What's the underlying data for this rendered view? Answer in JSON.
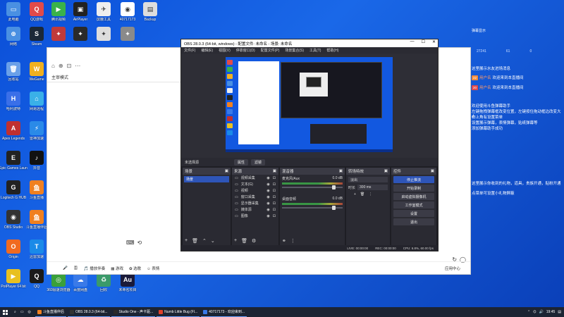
{
  "desktop": {
    "icons": [
      {
        "label": "此电脑",
        "color": "#4a90e2",
        "glyph": "▭"
      },
      {
        "label": "QQ游戏",
        "color": "#e24a4a",
        "glyph": "Q"
      },
      {
        "label": "腾讯视频",
        "color": "#3ab24a",
        "glyph": "▶"
      },
      {
        "label": "AirPlayer",
        "color": "#222",
        "glyph": "▣"
      },
      {
        "label": "屏蔽工具",
        "color": "#eee",
        "glyph": "✈"
      },
      {
        "label": "40717173",
        "color": "#fff",
        "glyph": "◉"
      },
      {
        "label": "Backup",
        "color": "#ddd",
        "glyph": "▤"
      },
      {
        "label": "网络",
        "color": "#4a90e2",
        "glyph": "⊕"
      },
      {
        "label": "Steam",
        "color": "#1b2838",
        "glyph": "S"
      },
      {
        "label": "",
        "color": "#c03a3a",
        "glyph": "✦"
      },
      {
        "label": "",
        "color": "#2a2a2a",
        "glyph": "✦"
      },
      {
        "label": "",
        "color": "#ddd",
        "glyph": "✦"
      },
      {
        "label": "",
        "color": "#8a8a8a",
        "glyph": "✦"
      },
      {
        "label": "回收站",
        "color": "#6aa0e8",
        "glyph": "🗑"
      },
      {
        "label": "WeGame",
        "color": "#f0b020",
        "glyph": "W"
      },
      {
        "label": "哈利波特",
        "color": "#3a6fe8",
        "glyph": "H"
      },
      {
        "label": "网易远程",
        "color": "#3ab0e8",
        "glyph": "⌂"
      },
      {
        "label": "Apex Legends",
        "color": "#c03030",
        "glyph": "A"
      },
      {
        "label": "雷神加速",
        "color": "#2a8ae8",
        "glyph": "⚡"
      },
      {
        "label": "Epic Games Launcher",
        "color": "#222",
        "glyph": "E"
      },
      {
        "label": "抖音",
        "color": "#111",
        "glyph": "♪"
      },
      {
        "label": "Logitech G HUB",
        "color": "#222",
        "glyph": "G"
      },
      {
        "label": "斗鱼直播",
        "color": "#f08020",
        "glyph": "鱼"
      },
      {
        "label": "OBS Studio",
        "color": "#333",
        "glyph": "◉"
      },
      {
        "label": "斗鱼直播伴侣",
        "color": "#f08020",
        "glyph": "鱼"
      },
      {
        "label": "Origin",
        "color": "#f06a20",
        "glyph": "O"
      },
      {
        "label": "迅雷加速",
        "color": "#1a8ae8",
        "glyph": "T"
      },
      {
        "label": "PotPlayer 64 bit",
        "color": "#e8c020",
        "glyph": "▶"
      },
      {
        "label": "QQ",
        "color": "#1a1a1a",
        "glyph": "Q"
      },
      {
        "label": "360极速浏览器",
        "color": "#3aa03a",
        "glyph": "◎"
      },
      {
        "label": "百度网盘",
        "color": "#3a7ae8",
        "glyph": "☁"
      },
      {
        "label": "回收",
        "color": "#3a9a6a",
        "glyph": "♻"
      },
      {
        "label": "未命名项目",
        "color": "#1a1a3a",
        "glyph": "Au"
      }
    ]
  },
  "helper": {
    "mode_label": "主审模式",
    "bottom_items": [
      "🎤",
      "🎚",
      "🎵 播放伴奏",
      "▦ 游戏",
      "✿ 选歌",
      "☺ 表情"
    ],
    "app_center": "应用中心"
  },
  "obs": {
    "title": "OBS 28.0.3 (64-bit, windows) - 配置文件: 未命名 - 场景: 未命名",
    "menus": [
      "文件(F)",
      "编辑(E)",
      "视图(V)",
      "停靠窗口(D)",
      "配置文件(P)",
      "场景集合(S)",
      "工具(T)",
      "帮助(H)"
    ],
    "context_label": "未选择源",
    "context_buttons": [
      "属性",
      "滤镜"
    ],
    "docks": {
      "scenes": {
        "title": "场景",
        "items": [
          "场景"
        ]
      },
      "sources": {
        "title": "来源",
        "items": [
          "视频采集",
          "文本(G)",
          "视频",
          "窗口采集",
          "显示器采集",
          "媒体源",
          "图像"
        ]
      },
      "mixer": {
        "title": "混音器",
        "channels": [
          {
            "name": "麦克风/Aux",
            "db": "0.0 dB"
          },
          {
            "name": "桌面音频",
            "db": "0.0 dB"
          }
        ]
      },
      "transitions": {
        "title": "转场特效",
        "selected": "淡出",
        "duration_label": "时长",
        "duration_value": "300 ms"
      },
      "controls": {
        "title": "控件",
        "buttons": [
          "停止推流",
          "开始录制",
          "启动虚拟摄像机",
          "工作室模式",
          "设置",
          "退出"
        ]
      }
    },
    "status": {
      "live": "LIVE: 00:00:00",
      "rec": "REC: 00:00:00",
      "cpu": "CPU: 6.8%, 60.00 fps"
    }
  },
  "chat": {
    "title": "弹幕显示",
    "stats": [
      "27241",
      "61",
      "0"
    ],
    "messages": [
      {
        "type": "system",
        "text": "这里展示水友进场消息"
      },
      {
        "type": "entry",
        "tag": "22",
        "user": "用户名",
        "text": "欢迎来到本直播间"
      },
      {
        "type": "entry",
        "tag": "20",
        "user": "用户名",
        "text": "欢迎来到本直播间"
      },
      {
        "type": "system",
        "text": "欢迎使用斗鱼弹幕助手"
      },
      {
        "type": "system",
        "text": "左键拖拽弹幕框改变位置，左键按住拖动框边改变大小"
      },
      {
        "type": "system",
        "text": "右上角有设置菜单"
      },
      {
        "type": "system",
        "text": "设置展示弹幕，表情弹幕，贴纸弹幕等"
      },
      {
        "type": "system",
        "text": "添加弹幕助手成功"
      },
      {
        "type": "system",
        "text": "这里展示你收到的礼物，道具，贵族开通，贴粉开通"
      },
      {
        "type": "system",
        "text": "点菜单可设置小礼物屏蔽"
      }
    ]
  },
  "taskbar": {
    "items": [
      {
        "label": "斗鱼直播伴侣",
        "color": "#f08020"
      },
      {
        "label": "OBS 28.0.3 (64-bit...",
        "color": "#333"
      },
      {
        "label": "Studio One - 声卡驱...",
        "color": "#2a2a2a"
      },
      {
        "label": "Numb Little Bug (Fl...",
        "color": "#e0402a"
      },
      {
        "label": "40717173 - 欢迎来到...",
        "color": "#3a7ae8"
      }
    ],
    "time": "19:45"
  }
}
